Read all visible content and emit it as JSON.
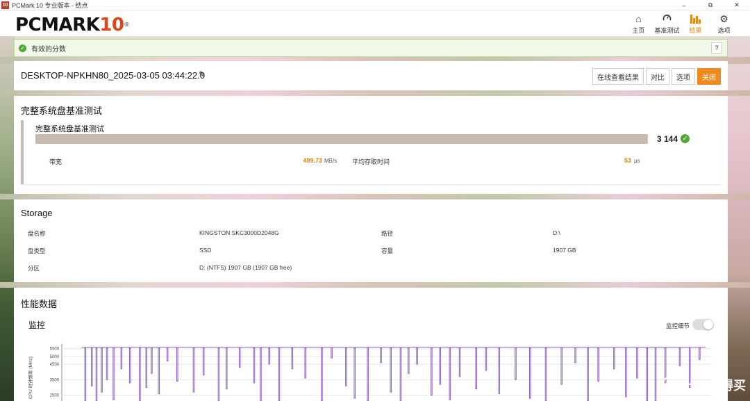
{
  "window": {
    "title": "PCMark 10 专业版本 - 结点",
    "app_icon": "10",
    "controls": [
      "–",
      "⧉",
      "✕"
    ]
  },
  "logo": {
    "text": "PCMARK",
    "number": "10",
    "reg": "®"
  },
  "nav": [
    {
      "label": "主页",
      "icon": "home-icon"
    },
    {
      "label": "基准测试",
      "icon": "gauge-icon"
    },
    {
      "label": "结果",
      "icon": "bar-chart-icon",
      "active": true
    },
    {
      "label": "选项",
      "icon": "gear-icon"
    }
  ],
  "valid_banner": {
    "text": "有效的分数",
    "help": "?"
  },
  "result": {
    "name": "DESKTOP-NPKHN80_2025-03-05 03:44:22.0",
    "buttons": {
      "online": "在线查看结果",
      "compare": "对比",
      "options": "选项",
      "close": "关闭"
    }
  },
  "benchmark": {
    "section_title": "完整系统盘基准测试",
    "card_title": "完整系统盘基准测试",
    "score": "3 144",
    "bandwidth_label": "带宽",
    "bandwidth_value": "499.73",
    "bandwidth_unit": "MB/s",
    "latency_label": "平均存取时间",
    "latency_value": "53",
    "latency_unit": "μs"
  },
  "storage": {
    "title": "Storage",
    "rows": [
      {
        "k1": "盘名称",
        "v1": "KINGSTON SKC3000D2048G",
        "k2": "路径",
        "v2": "D:\\"
      },
      {
        "k1": "盘类型",
        "v1": "SSD",
        "k2": "容量",
        "v2": "1907 GB"
      },
      {
        "k1": "分区",
        "v1": "D: (NTFS) 1907 GB (1907 GB free)",
        "k2": "",
        "v2": ""
      }
    ]
  },
  "performance": {
    "title": "性能数据",
    "monitor_title": "监控",
    "toggle_label": "监控细节",
    "toggle_on": false
  },
  "chart_data": {
    "type": "line",
    "ylabel": "CPU 时钟频率 (MHz)",
    "yticks": [
      5500,
      5000,
      4500,
      3500,
      2500,
      2000
    ],
    "ylim": [
      1500,
      5800
    ],
    "series": [
      {
        "color": "#8e5fc0",
        "baseline": 5600
      }
    ],
    "dips": [
      [
        0.035,
        2000
      ],
      [
        0.045,
        3100
      ],
      [
        0.052,
        1700
      ],
      [
        0.06,
        2700
      ],
      [
        0.068,
        3500
      ],
      [
        0.078,
        2200
      ],
      [
        0.09,
        4200
      ],
      [
        0.103,
        3300
      ],
      [
        0.118,
        1800
      ],
      [
        0.128,
        3000
      ],
      [
        0.136,
        3900
      ],
      [
        0.147,
        2600
      ],
      [
        0.16,
        4700
      ],
      [
        0.175,
        3400
      ],
      [
        0.2,
        2700
      ],
      [
        0.215,
        3800
      ],
      [
        0.238,
        1600
      ],
      [
        0.25,
        2900
      ],
      [
        0.27,
        4300
      ],
      [
        0.292,
        3300
      ],
      [
        0.302,
        1900
      ],
      [
        0.315,
        4500
      ],
      [
        0.33,
        2100
      ],
      [
        0.35,
        4200
      ],
      [
        0.37,
        3600
      ],
      [
        0.395,
        2000
      ],
      [
        0.41,
        4900
      ],
      [
        0.432,
        3100
      ],
      [
        0.445,
        2300
      ],
      [
        0.465,
        1800
      ],
      [
        0.485,
        4600
      ],
      [
        0.5,
        2700
      ],
      [
        0.515,
        1700
      ],
      [
        0.527,
        3900
      ],
      [
        0.54,
        4500
      ],
      [
        0.562,
        2500
      ],
      [
        0.575,
        3200
      ],
      [
        0.59,
        2200
      ],
      [
        0.605,
        3700
      ],
      [
        0.63,
        2900
      ],
      [
        0.645,
        4100
      ],
      [
        0.665,
        2600
      ],
      [
        0.69,
        3500
      ],
      [
        0.712,
        2300
      ],
      [
        0.736,
        1800
      ],
      [
        0.76,
        3200
      ],
      [
        0.781,
        4600
      ],
      [
        0.8,
        1600
      ],
      [
        0.816,
        3400
      ],
      [
        0.84,
        4200
      ],
      [
        0.858,
        2400
      ],
      [
        0.875,
        3600
      ],
      [
        0.89,
        2100
      ],
      [
        0.903,
        1800
      ],
      [
        0.918,
        3300
      ],
      [
        0.94,
        4400
      ],
      [
        0.955,
        3000
      ],
      [
        0.97,
        4800
      ]
    ]
  }
}
